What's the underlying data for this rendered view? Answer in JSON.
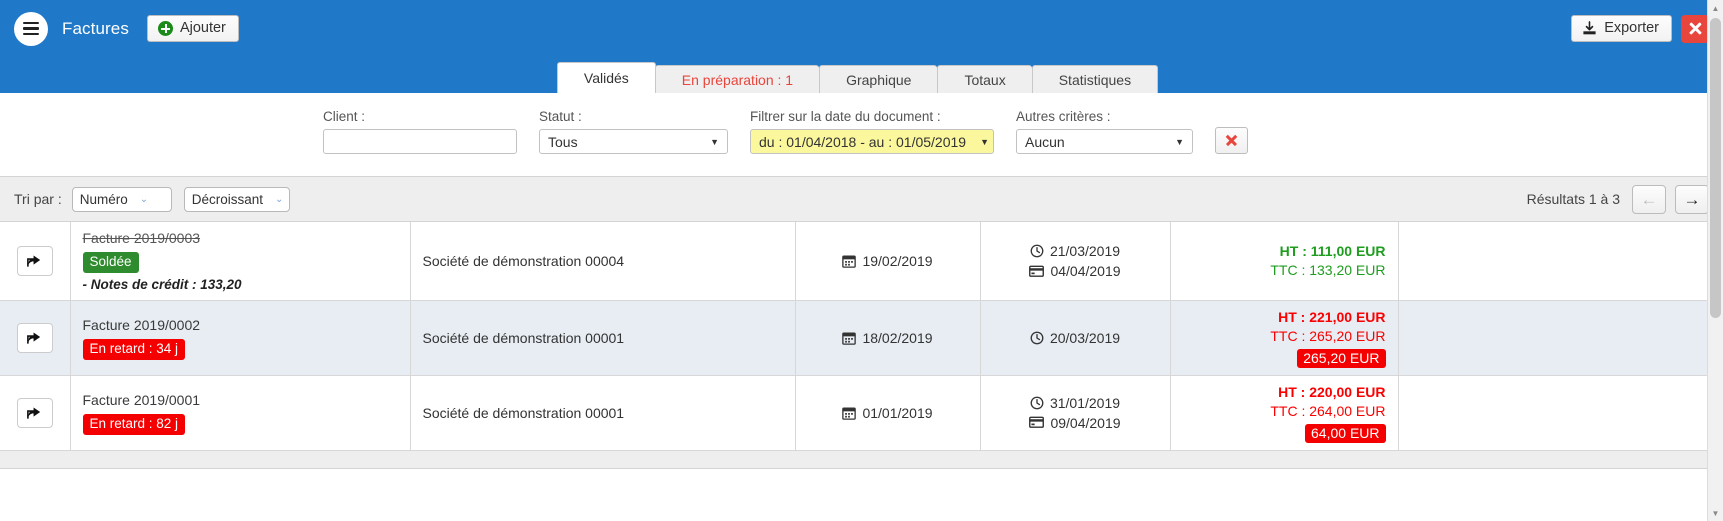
{
  "header": {
    "menu_icon": "hamburger-icon",
    "title": "Factures",
    "add_label": "Ajouter",
    "add_icon": "plus-circle-icon",
    "export_label": "Exporter",
    "export_icon": "download-icon",
    "close_icon": "close-icon"
  },
  "tabs": [
    {
      "label": "Validés",
      "active": true,
      "alert": false
    },
    {
      "label": "En préparation : 1",
      "active": false,
      "alert": true
    },
    {
      "label": "Graphique",
      "active": false,
      "alert": false
    },
    {
      "label": "Totaux",
      "active": false,
      "alert": false
    },
    {
      "label": "Statistiques",
      "active": false,
      "alert": false
    }
  ],
  "filters": {
    "client_label": "Client :",
    "client_value": "",
    "client_placeholder": "",
    "statut_label": "Statut :",
    "statut_value": "Tous",
    "date_label": "Filtrer sur la date du document :",
    "date_value": "du : 01/04/2018 - au : 01/05/2019",
    "autres_label": "Autres critères :",
    "autres_value": "Aucun",
    "clear_icon": "clear-filters-icon"
  },
  "sort": {
    "label": "Tri par :",
    "field_value": "Numéro",
    "direction_value": "Décroissant",
    "results_text": "Résultats 1 à 3",
    "prev_icon": "arrow-left-icon",
    "next_icon": "arrow-right-icon"
  },
  "rows": [
    {
      "action_icon": "share-arrow-icon",
      "doc_name": "Facture 2019/0003",
      "struck": true,
      "badge": {
        "text": "Soldée",
        "color": "green"
      },
      "credit_note": "- Notes de crédit : 133,20",
      "client": "Société de démonstration 00004",
      "doc_date": "19/02/2019",
      "due_date": "21/03/2019",
      "pay_date": "04/04/2019",
      "ht": "HT : 111,00 EUR",
      "ttc": "TTC : 133,20 EUR",
      "amount_color": "green",
      "due_badge": null,
      "alt": false
    },
    {
      "action_icon": "share-arrow-icon",
      "doc_name": "Facture 2019/0002",
      "struck": false,
      "badge": {
        "text": "En retard : 34 j",
        "color": "red"
      },
      "credit_note": null,
      "client": "Société de démonstration 00001",
      "doc_date": "18/02/2019",
      "due_date": "20/03/2019",
      "pay_date": null,
      "ht": "HT : 221,00 EUR",
      "ttc": "TTC : 265,20 EUR",
      "amount_color": "red",
      "due_badge": "265,20 EUR",
      "alt": true
    },
    {
      "action_icon": "share-arrow-icon",
      "doc_name": "Facture 2019/0001",
      "struck": false,
      "badge": {
        "text": "En retard : 82 j",
        "color": "red"
      },
      "credit_note": null,
      "client": "Société de démonstration 00001",
      "doc_date": "01/01/2019",
      "due_date": "31/01/2019",
      "pay_date": "09/04/2019",
      "ht": "HT : 220,00 EUR",
      "ttc": "TTC : 264,00 EUR",
      "amount_color": "red",
      "due_badge": "64,00 EUR",
      "alt": false
    }
  ],
  "icons": {
    "calendar": "calendar-icon",
    "clock": "clock-icon",
    "card": "credit-card-icon"
  },
  "colors": {
    "brand_blue": "#1f78c8",
    "green": "#1f9d1f",
    "red": "#fa0000",
    "badge_green": "#2e8b2e",
    "badge_red": "#f50000",
    "row_alt": "#e7edf3",
    "date_highlight": "#fbf79c"
  }
}
